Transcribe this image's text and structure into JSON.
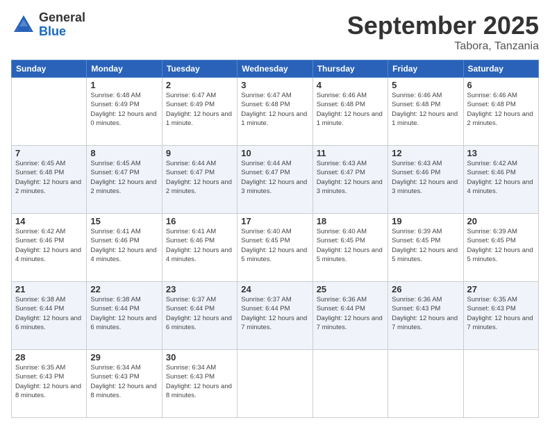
{
  "logo": {
    "general": "General",
    "blue": "Blue"
  },
  "header": {
    "month": "September 2025",
    "location": "Tabora, Tanzania"
  },
  "weekdays": [
    "Sunday",
    "Monday",
    "Tuesday",
    "Wednesday",
    "Thursday",
    "Friday",
    "Saturday"
  ],
  "weeks": [
    [
      {
        "day": "",
        "sunrise": "",
        "sunset": "",
        "daylight": ""
      },
      {
        "day": "1",
        "sunrise": "Sunrise: 6:48 AM",
        "sunset": "Sunset: 6:49 PM",
        "daylight": "Daylight: 12 hours and 0 minutes."
      },
      {
        "day": "2",
        "sunrise": "Sunrise: 6:47 AM",
        "sunset": "Sunset: 6:49 PM",
        "daylight": "Daylight: 12 hours and 1 minute."
      },
      {
        "day": "3",
        "sunrise": "Sunrise: 6:47 AM",
        "sunset": "Sunset: 6:48 PM",
        "daylight": "Daylight: 12 hours and 1 minute."
      },
      {
        "day": "4",
        "sunrise": "Sunrise: 6:46 AM",
        "sunset": "Sunset: 6:48 PM",
        "daylight": "Daylight: 12 hours and 1 minute."
      },
      {
        "day": "5",
        "sunrise": "Sunrise: 6:46 AM",
        "sunset": "Sunset: 6:48 PM",
        "daylight": "Daylight: 12 hours and 1 minute."
      },
      {
        "day": "6",
        "sunrise": "Sunrise: 6:46 AM",
        "sunset": "Sunset: 6:48 PM",
        "daylight": "Daylight: 12 hours and 2 minutes."
      }
    ],
    [
      {
        "day": "7",
        "sunrise": "Sunrise: 6:45 AM",
        "sunset": "Sunset: 6:48 PM",
        "daylight": "Daylight: 12 hours and 2 minutes."
      },
      {
        "day": "8",
        "sunrise": "Sunrise: 6:45 AM",
        "sunset": "Sunset: 6:47 PM",
        "daylight": "Daylight: 12 hours and 2 minutes."
      },
      {
        "day": "9",
        "sunrise": "Sunrise: 6:44 AM",
        "sunset": "Sunset: 6:47 PM",
        "daylight": "Daylight: 12 hours and 2 minutes."
      },
      {
        "day": "10",
        "sunrise": "Sunrise: 6:44 AM",
        "sunset": "Sunset: 6:47 PM",
        "daylight": "Daylight: 12 hours and 3 minutes."
      },
      {
        "day": "11",
        "sunrise": "Sunrise: 6:43 AM",
        "sunset": "Sunset: 6:47 PM",
        "daylight": "Daylight: 12 hours and 3 minutes."
      },
      {
        "day": "12",
        "sunrise": "Sunrise: 6:43 AM",
        "sunset": "Sunset: 6:46 PM",
        "daylight": "Daylight: 12 hours and 3 minutes."
      },
      {
        "day": "13",
        "sunrise": "Sunrise: 6:42 AM",
        "sunset": "Sunset: 6:46 PM",
        "daylight": "Daylight: 12 hours and 4 minutes."
      }
    ],
    [
      {
        "day": "14",
        "sunrise": "Sunrise: 6:42 AM",
        "sunset": "Sunset: 6:46 PM",
        "daylight": "Daylight: 12 hours and 4 minutes."
      },
      {
        "day": "15",
        "sunrise": "Sunrise: 6:41 AM",
        "sunset": "Sunset: 6:46 PM",
        "daylight": "Daylight: 12 hours and 4 minutes."
      },
      {
        "day": "16",
        "sunrise": "Sunrise: 6:41 AM",
        "sunset": "Sunset: 6:46 PM",
        "daylight": "Daylight: 12 hours and 4 minutes."
      },
      {
        "day": "17",
        "sunrise": "Sunrise: 6:40 AM",
        "sunset": "Sunset: 6:45 PM",
        "daylight": "Daylight: 12 hours and 5 minutes."
      },
      {
        "day": "18",
        "sunrise": "Sunrise: 6:40 AM",
        "sunset": "Sunset: 6:45 PM",
        "daylight": "Daylight: 12 hours and 5 minutes."
      },
      {
        "day": "19",
        "sunrise": "Sunrise: 6:39 AM",
        "sunset": "Sunset: 6:45 PM",
        "daylight": "Daylight: 12 hours and 5 minutes."
      },
      {
        "day": "20",
        "sunrise": "Sunrise: 6:39 AM",
        "sunset": "Sunset: 6:45 PM",
        "daylight": "Daylight: 12 hours and 5 minutes."
      }
    ],
    [
      {
        "day": "21",
        "sunrise": "Sunrise: 6:38 AM",
        "sunset": "Sunset: 6:44 PM",
        "daylight": "Daylight: 12 hours and 6 minutes."
      },
      {
        "day": "22",
        "sunrise": "Sunrise: 6:38 AM",
        "sunset": "Sunset: 6:44 PM",
        "daylight": "Daylight: 12 hours and 6 minutes."
      },
      {
        "day": "23",
        "sunrise": "Sunrise: 6:37 AM",
        "sunset": "Sunset: 6:44 PM",
        "daylight": "Daylight: 12 hours and 6 minutes."
      },
      {
        "day": "24",
        "sunrise": "Sunrise: 6:37 AM",
        "sunset": "Sunset: 6:44 PM",
        "daylight": "Daylight: 12 hours and 7 minutes."
      },
      {
        "day": "25",
        "sunrise": "Sunrise: 6:36 AM",
        "sunset": "Sunset: 6:44 PM",
        "daylight": "Daylight: 12 hours and 7 minutes."
      },
      {
        "day": "26",
        "sunrise": "Sunrise: 6:36 AM",
        "sunset": "Sunset: 6:43 PM",
        "daylight": "Daylight: 12 hours and 7 minutes."
      },
      {
        "day": "27",
        "sunrise": "Sunrise: 6:35 AM",
        "sunset": "Sunset: 6:43 PM",
        "daylight": "Daylight: 12 hours and 7 minutes."
      }
    ],
    [
      {
        "day": "28",
        "sunrise": "Sunrise: 6:35 AM",
        "sunset": "Sunset: 6:43 PM",
        "daylight": "Daylight: 12 hours and 8 minutes."
      },
      {
        "day": "29",
        "sunrise": "Sunrise: 6:34 AM",
        "sunset": "Sunset: 6:43 PM",
        "daylight": "Daylight: 12 hours and 8 minutes."
      },
      {
        "day": "30",
        "sunrise": "Sunrise: 6:34 AM",
        "sunset": "Sunset: 6:43 PM",
        "daylight": "Daylight: 12 hours and 8 minutes."
      },
      {
        "day": "",
        "sunrise": "",
        "sunset": "",
        "daylight": ""
      },
      {
        "day": "",
        "sunrise": "",
        "sunset": "",
        "daylight": ""
      },
      {
        "day": "",
        "sunrise": "",
        "sunset": "",
        "daylight": ""
      },
      {
        "day": "",
        "sunrise": "",
        "sunset": "",
        "daylight": ""
      }
    ]
  ]
}
